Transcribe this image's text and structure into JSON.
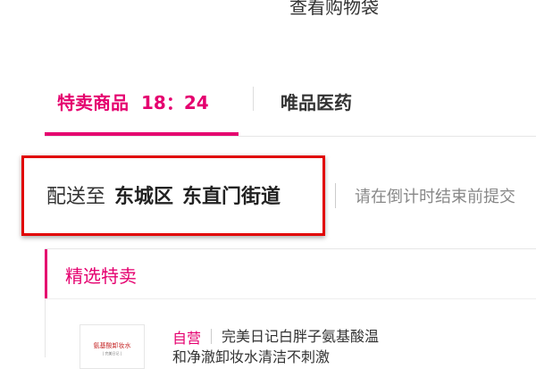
{
  "header": {
    "cart_link": "查看购物袋"
  },
  "tabs": {
    "active_label": "特卖商品",
    "active_time": "18：24",
    "other_label": "唯品医药"
  },
  "delivery": {
    "prefix": "配送至",
    "district": "东城区",
    "street": "东直门街道",
    "notice": "请在倒计时结束前提交"
  },
  "section": {
    "title": "精选特卖"
  },
  "product": {
    "image_text": "氨基酸卸妆水",
    "image_subtext": "| 完美日记 |",
    "badge": "自营",
    "title_line1": "完美日记白胖子氨基酸温",
    "title_line2": "和净澈卸妆水清洁不刺激"
  },
  "colors": {
    "accent": "#e5006f",
    "highlight_border": "#e10000"
  }
}
